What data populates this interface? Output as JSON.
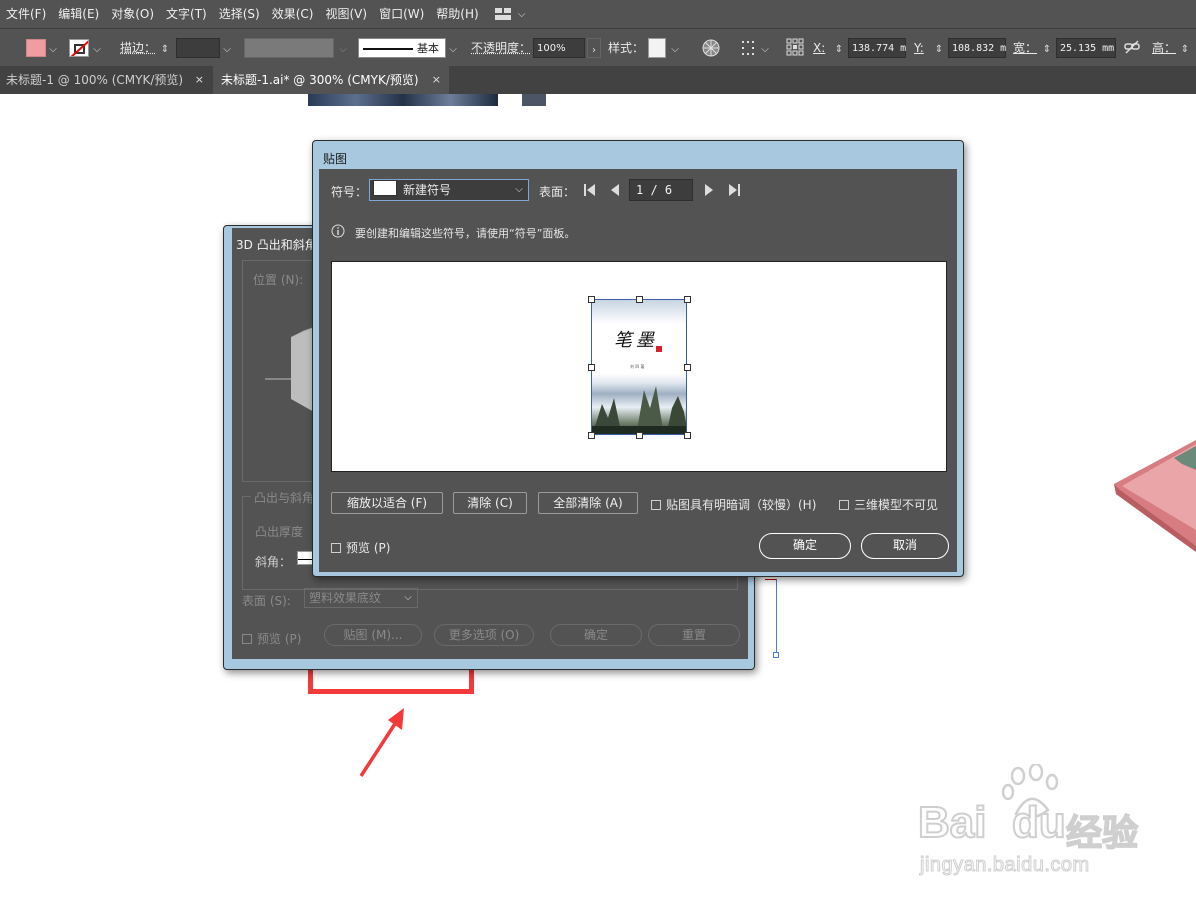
{
  "menubar": {
    "items": [
      "文件(F)",
      "编辑(E)",
      "对象(O)",
      "文字(T)",
      "选择(S)",
      "效果(C)",
      "视图(V)",
      "窗口(W)",
      "帮助(H)"
    ]
  },
  "controlbar": {
    "fill_color": "#f19ca0",
    "stroke_label": "描边：",
    "stroke_style_label": "基本",
    "opacity_label": "不透明度：",
    "opacity_value": "100%",
    "style_label": "样式：",
    "x_label": "X:",
    "x_value": "138.774 m",
    "y_label": "Y:",
    "y_value": "108.832 m",
    "w_label": "宽：",
    "w_value": "25.135 mm",
    "h_label": "高："
  },
  "tabs": [
    {
      "label": "未标题-1 @ 100% (CMYK/预览)",
      "close": "×"
    },
    {
      "label": "未标题-1.ai* @ 300% (CMYK/预览)",
      "close": "×"
    }
  ],
  "bg_dialog": {
    "title": "3D 凸出和斜角",
    "position_label": "位置 (N):",
    "extrude_group_label": "凸出与斜角",
    "depth_label": "凸出厚度",
    "bevel_label": "斜角：",
    "surface_label": "表面 (S):",
    "surface_value": "塑料效果底纹",
    "preview_label": "预览 (P)",
    "map_button": "贴图 (M)...",
    "more_button": "更多选项 (O)",
    "ok_button": "确定",
    "reset_button": "重置"
  },
  "map_dialog": {
    "title": "贴图",
    "symbol_label": "符号：",
    "symbol_value": "新建符号",
    "surface_label": "表面：",
    "surface_page": "1 / 6",
    "info_text": "要创建和编辑这些符号，请使用“符号”面板。",
    "cover_title": "笔墨",
    "cover_author": "刘 四 著",
    "scale_button": "缩放以适合 (F)",
    "clear_button": "清除 (C)",
    "clear_all_button": "全部清除 (A)",
    "shade_label": "贴图具有明暗调（较慢）(H)",
    "invisible_label": "三维模型不可见",
    "preview_label": "预览 (P)",
    "ok_button": "确定",
    "cancel_button": "取消"
  },
  "watermark": {
    "brand_text": "Bai",
    "brand_du": "du",
    "brand_cn": "经验",
    "url": "jingyan.baidu.com"
  },
  "colors": {
    "highlight_red": "#f23a3a",
    "dialog_bg": "#535353",
    "dialog_border": "#a8c8e0"
  }
}
